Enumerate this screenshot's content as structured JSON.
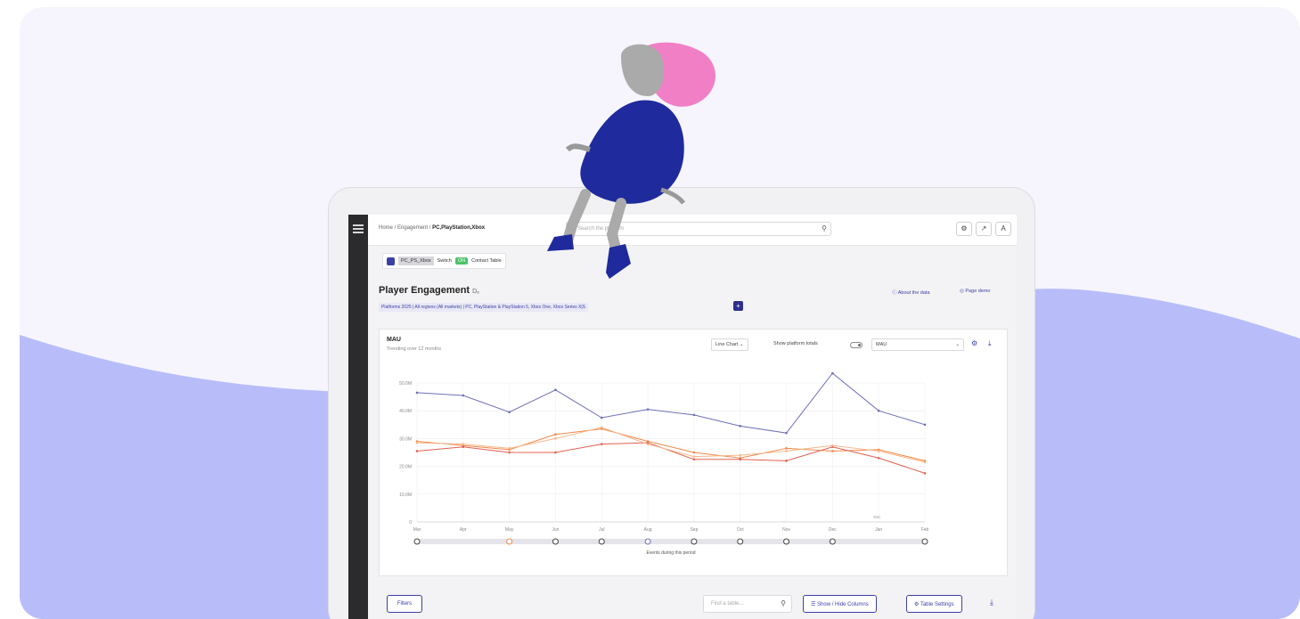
{
  "colors": {
    "background": "#f6f5fe",
    "wave": "#b8bdfa",
    "accent": "#3b3fa6",
    "sidebar": "#2b2b2e"
  },
  "topbar": {
    "breadcrumb_home": "Home",
    "breadcrumb_section": "Engagement",
    "breadcrumb_current": "PC,PlayStation,Xbox",
    "search_placeholder": "Search the platform",
    "icons": [
      "settings-icon",
      "share-icon",
      "font-icon"
    ]
  },
  "page_tabs": {
    "tab_name": "PC_PS_Xbox",
    "switch_label": "Switch",
    "switch_state": "ON",
    "contact_label": "Contact Table"
  },
  "header": {
    "title": "Player Engagement",
    "title_suffix": "Dₑ",
    "filter_summary": "Platforms 2025  |  All regions (All markets)  |  PC, PlayStation & PlayStation 5, Xbox One, Xbox Series X|S",
    "about_link": "About the data",
    "page_demo_link": "Page demo"
  },
  "chart_card": {
    "title": "MAU",
    "subtitle": "Trending over 12 months",
    "chart_type_label": "Line Chart",
    "platform_totals_label": "Show platform totals",
    "metric_select": "MAU",
    "events_label": "Events during this period"
  },
  "chart_data": {
    "type": "line",
    "categories": [
      "Mar",
      "Apr",
      "May",
      "Jun",
      "Jul",
      "Aug",
      "Sep",
      "Oct",
      "Nov",
      "Dec",
      "Jan",
      "Feb"
    ],
    "y_ticks": [
      "0",
      "10.0M",
      "20.0M",
      "30.0M",
      "40.0M",
      "50.0M"
    ],
    "ylim": [
      0,
      50
    ],
    "grid": true,
    "annotation": "Dec",
    "series": [
      {
        "color": "#6e6fb8",
        "values": [
          46.5,
          45.5,
          39.5,
          47.5,
          37.5,
          40.5,
          38.5,
          34.5,
          32.0,
          53.5,
          40.0,
          35.0
        ]
      },
      {
        "color": "#f08a4b",
        "values": [
          29.0,
          27.5,
          26.0,
          31.5,
          33.5,
          29.0,
          25.0,
          23.0,
          26.5,
          25.5,
          26.0,
          22.0
        ]
      },
      {
        "color": "#e06050",
        "values": [
          25.5,
          27.0,
          25.0,
          25.0,
          28.0,
          28.5,
          22.5,
          22.5,
          22.0,
          27.0,
          23.0,
          17.5
        ]
      },
      {
        "color": "#f4b78a",
        "values": [
          28.5,
          28.0,
          26.5,
          30.0,
          34.0,
          28.0,
          23.5,
          24.0,
          25.5,
          27.5,
          25.5,
          21.5
        ]
      }
    ],
    "events": [
      "Mar",
      "May",
      "Jun",
      "Jul",
      "Aug",
      "Sep",
      "Oct",
      "Nov",
      "Dec",
      "Feb"
    ]
  },
  "table_toolbar": {
    "filters_label": "Filters",
    "find_placeholder": "Find a table...",
    "show_hide_label": "Show / Hide Columns",
    "table_settings_label": "Table Settings"
  }
}
